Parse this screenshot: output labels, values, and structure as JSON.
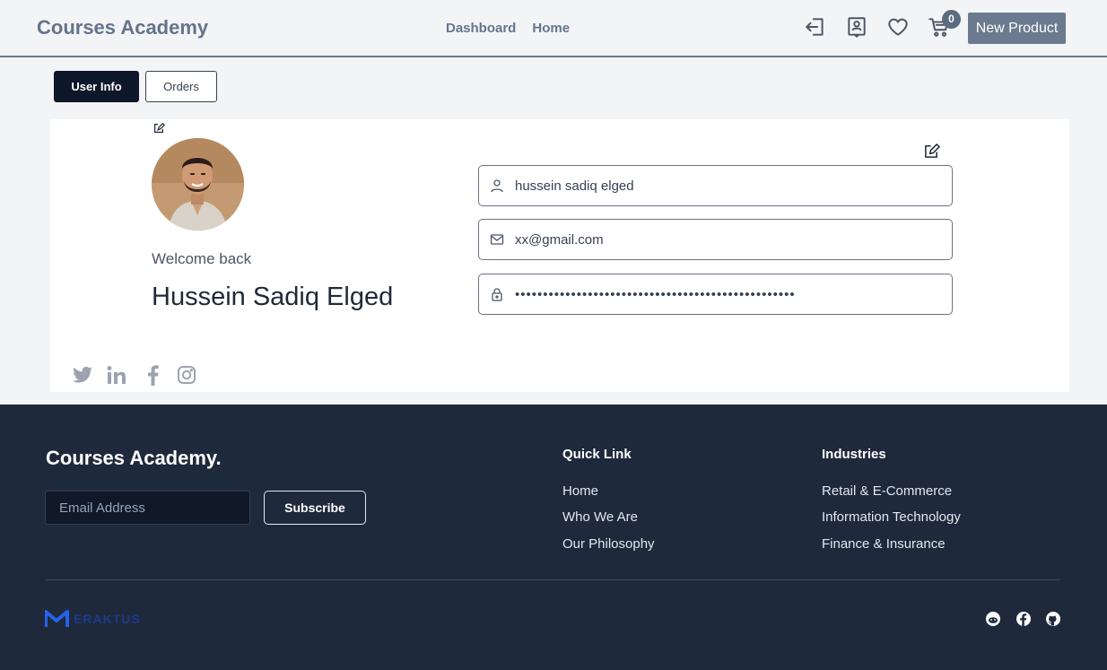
{
  "header": {
    "brand": "Courses Academy",
    "nav": [
      "Dashboard",
      "Home"
    ],
    "cart_count": "0",
    "new_product_label": "New Product"
  },
  "tabs": [
    "User Info",
    "Orders"
  ],
  "profile": {
    "welcome": "Welcome back",
    "full_name": "Hussein Sadiq Elged",
    "name_value": "hussein sadiq elged",
    "email_value": "xx@gmail.com",
    "password_value": "••••••••••••••••••••••••••••••••••••••••••••••••••"
  },
  "social_icons": [
    "twitter-icon",
    "linkedin-icon",
    "facebook-icon",
    "instagram-icon"
  ],
  "footer": {
    "brand": "Courses Academy.",
    "email_placeholder": "Email Address",
    "subscribe_label": "Subscribe",
    "quick_link_title": "Quick Link",
    "quick_links": [
      "Home",
      "Who We Are",
      "Our Philosophy"
    ],
    "industries_title": "Industries",
    "industries": [
      "Retail & E-Commerce",
      "Information Technology",
      "Finance & Insurance"
    ],
    "logo_text": "ERAKTUS",
    "social_icons": [
      "reddit-icon",
      "facebook-icon",
      "github-icon"
    ]
  },
  "colors": {
    "accent": "#6b7a8f",
    "dark": "#0f172a",
    "footer_bg": "#1e293b",
    "logo_blue": "#2563eb"
  }
}
